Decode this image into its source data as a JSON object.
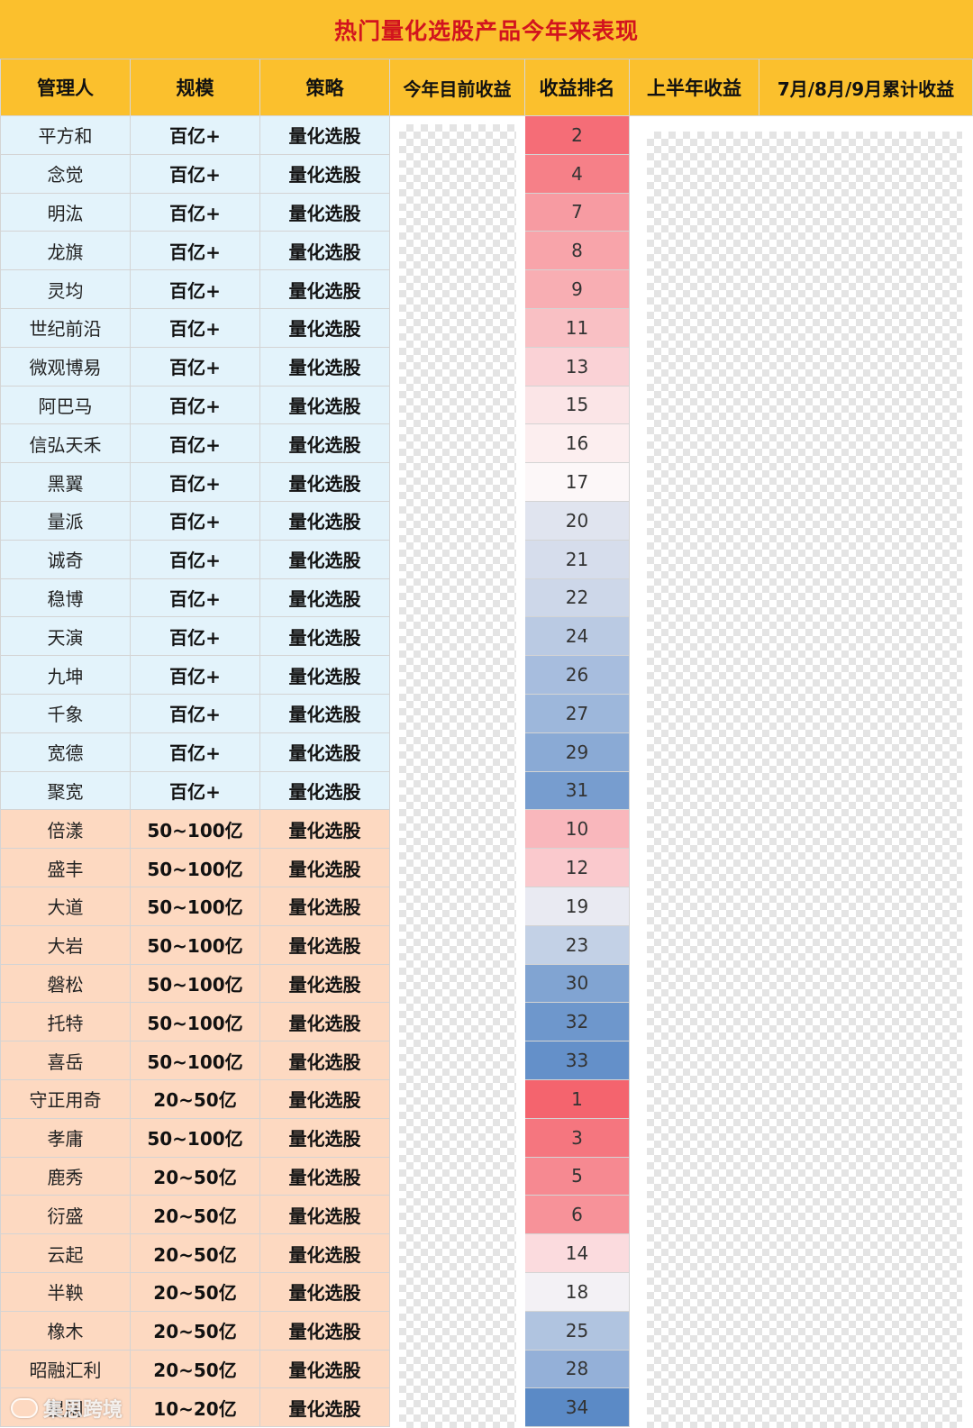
{
  "title": "热门量化选股产品今年来表现",
  "columns": [
    "管理人",
    "规模",
    "策略",
    "今年目前收益",
    "收益排名",
    "上半年收益",
    "7月/8月/9月累计收益"
  ],
  "rows": [
    {
      "manager": "平方和",
      "scale": "百亿+",
      "strategy": "量化选股",
      "rank": "2"
    },
    {
      "manager": "念觉",
      "scale": "百亿+",
      "strategy": "量化选股",
      "rank": "4"
    },
    {
      "manager": "明汯",
      "scale": "百亿+",
      "strategy": "量化选股",
      "rank": "7"
    },
    {
      "manager": "龙旗",
      "scale": "百亿+",
      "strategy": "量化选股",
      "rank": "8"
    },
    {
      "manager": "灵均",
      "scale": "百亿+",
      "strategy": "量化选股",
      "rank": "9"
    },
    {
      "manager": "世纪前沿",
      "scale": "百亿+",
      "strategy": "量化选股",
      "rank": "11"
    },
    {
      "manager": "微观博易",
      "scale": "百亿+",
      "strategy": "量化选股",
      "rank": "13"
    },
    {
      "manager": "阿巴马",
      "scale": "百亿+",
      "strategy": "量化选股",
      "rank": "15"
    },
    {
      "manager": "信弘天禾",
      "scale": "百亿+",
      "strategy": "量化选股",
      "rank": "16"
    },
    {
      "manager": "黑翼",
      "scale": "百亿+",
      "strategy": "量化选股",
      "rank": "17"
    },
    {
      "manager": "量派",
      "scale": "百亿+",
      "strategy": "量化选股",
      "rank": "20"
    },
    {
      "manager": "诚奇",
      "scale": "百亿+",
      "strategy": "量化选股",
      "rank": "21"
    },
    {
      "manager": "稳博",
      "scale": "百亿+",
      "strategy": "量化选股",
      "rank": "22"
    },
    {
      "manager": "天演",
      "scale": "百亿+",
      "strategy": "量化选股",
      "rank": "24"
    },
    {
      "manager": "九坤",
      "scale": "百亿+",
      "strategy": "量化选股",
      "rank": "26"
    },
    {
      "manager": "千象",
      "scale": "百亿+",
      "strategy": "量化选股",
      "rank": "27"
    },
    {
      "manager": "宽德",
      "scale": "百亿+",
      "strategy": "量化选股",
      "rank": "29"
    },
    {
      "manager": "聚宽",
      "scale": "百亿+",
      "strategy": "量化选股",
      "rank": "31"
    },
    {
      "manager": "倍漾",
      "scale": "50~100亿",
      "strategy": "量化选股",
      "rank": "10"
    },
    {
      "manager": "盛丰",
      "scale": "50~100亿",
      "strategy": "量化选股",
      "rank": "12"
    },
    {
      "manager": "大道",
      "scale": "50~100亿",
      "strategy": "量化选股",
      "rank": "19"
    },
    {
      "manager": "大岩",
      "scale": "50~100亿",
      "strategy": "量化选股",
      "rank": "23"
    },
    {
      "manager": "磐松",
      "scale": "50~100亿",
      "strategy": "量化选股",
      "rank": "30"
    },
    {
      "manager": "托特",
      "scale": "50~100亿",
      "strategy": "量化选股",
      "rank": "32"
    },
    {
      "manager": "喜岳",
      "scale": "50~100亿",
      "strategy": "量化选股",
      "rank": "33"
    },
    {
      "manager": "守正用奇",
      "scale": "20~50亿",
      "strategy": "量化选股",
      "rank": "1"
    },
    {
      "manager": "孝庸",
      "scale": "50~100亿",
      "strategy": "量化选股",
      "rank": "3"
    },
    {
      "manager": "鹿秀",
      "scale": "20~50亿",
      "strategy": "量化选股",
      "rank": "5"
    },
    {
      "manager": "衍盛",
      "scale": "20~50亿",
      "strategy": "量化选股",
      "rank": "6"
    },
    {
      "manager": "云起",
      "scale": "20~50亿",
      "strategy": "量化选股",
      "rank": "14"
    },
    {
      "manager": "半鞅",
      "scale": "20~50亿",
      "strategy": "量化选股",
      "rank": "18"
    },
    {
      "manager": "橡木",
      "scale": "20~50亿",
      "strategy": "量化选股",
      "rank": "25"
    },
    {
      "manager": "昭融汇利",
      "scale": "20~50亿",
      "strategy": "量化选股",
      "rank": "28"
    },
    {
      "manager": "星阔",
      "scale": "10~20亿",
      "strategy": "量化选股",
      "rank": "34"
    }
  ],
  "colors": {
    "header_bg": "#fbc02d",
    "title_text": "#d2141e",
    "group_billion_bg": "#e3f3fb",
    "group_other_bg": "#fdd9c1",
    "rank_best": "#f4646e",
    "rank_mid": "#fcf7f8",
    "rank_worst": "#5b8ac6"
  },
  "watermark": "集思跨境"
}
